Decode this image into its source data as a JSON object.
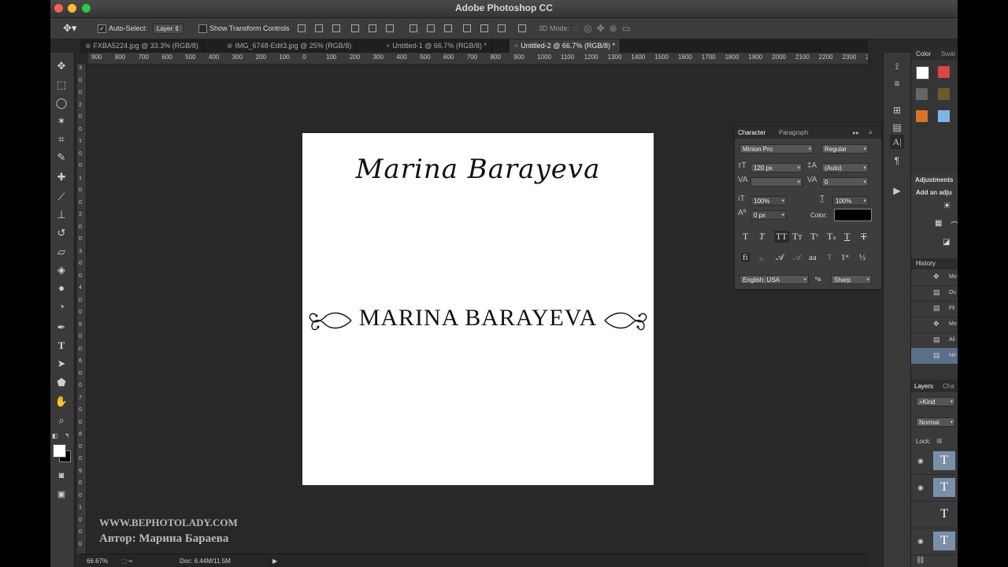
{
  "window": {
    "title": "Adobe Photoshop CC"
  },
  "options_bar": {
    "auto_select_label": "Auto-Select:",
    "auto_select_value": "Layer",
    "show_transform_label": "Show Transform Controls",
    "mode_3d_label": "3D Mode:"
  },
  "tabs": [
    {
      "label": "FXBA5224.jpg @ 33.3% (RGB/8)",
      "close": "⊗"
    },
    {
      "label": "IMG_6748-Edit3.jpg @ 25% (RGB/8)",
      "close": "⊗"
    },
    {
      "label": "Untitled-1 @ 66.7% (RGB/8) *",
      "close": "×"
    },
    {
      "label": "Untitled-2 @ 66.7% (RGB/8) *",
      "close": "×"
    }
  ],
  "ruler_h": [
    "900",
    "800",
    "700",
    "600",
    "500",
    "400",
    "300",
    "200",
    "100",
    "0",
    "100",
    "200",
    "300",
    "400",
    "500",
    "600",
    "700",
    "800",
    "900",
    "1000",
    "1100",
    "1200",
    "1300",
    "1400",
    "1500",
    "1600",
    "1700",
    "1800",
    "1900",
    "2000",
    "2100",
    "2200",
    "2300",
    "2"
  ],
  "ruler_v": [
    "3",
    "0",
    "0",
    "2",
    "0",
    "0",
    "1",
    "0",
    "0",
    "1",
    "0",
    "0",
    "2",
    "0",
    "0",
    "3",
    "0",
    "0",
    "4",
    "0",
    "0",
    "5",
    "0",
    "0",
    "6",
    "0",
    "0",
    "7",
    "0",
    "0",
    "8",
    "0",
    "0",
    "9",
    "0",
    "0",
    "1",
    "0",
    "0",
    "0"
  ],
  "canvas": {
    "script_text": "Marina Barayeva",
    "caps_text": "MARINA BARAYEVA"
  },
  "watermark": {
    "line1": "WWW.BEPHOTOLADY.COM",
    "line2": "Автор: Марина Бараева"
  },
  "status_bar": {
    "zoom": "66.67%",
    "doc": "Doc: 6.44M/11.5M"
  },
  "character_panel": {
    "tab_character": "Character",
    "tab_paragraph": "Paragraph",
    "font_family": "Minion Pro",
    "font_style": "Regular",
    "font_size": "120 px",
    "leading": "(Auto)",
    "tracking": "0",
    "vertical_scale": "100%",
    "horizontal_scale": "100%",
    "baseline_shift": "0 px",
    "color_label": "Color:",
    "language": "English: USA",
    "antialias_label": "ªa",
    "antialias": "Sharp",
    "color_value": "#000000"
  },
  "dock": {
    "color_tab": "Color",
    "swatches_tab": "Swat",
    "adjustments_title": "Adjustments",
    "adjustments_hint": "Add an adju",
    "history_title": "History",
    "history_items": [
      "Mo",
      "Du",
      "Fli",
      "Mo",
      "Ali",
      "Ne"
    ],
    "layers_tab": "Layers",
    "channels_tab": "Cha",
    "kind_label": "Kind",
    "blend_mode": "Normal",
    "lock_label": "Lock:",
    "layer_thumb": "T"
  }
}
